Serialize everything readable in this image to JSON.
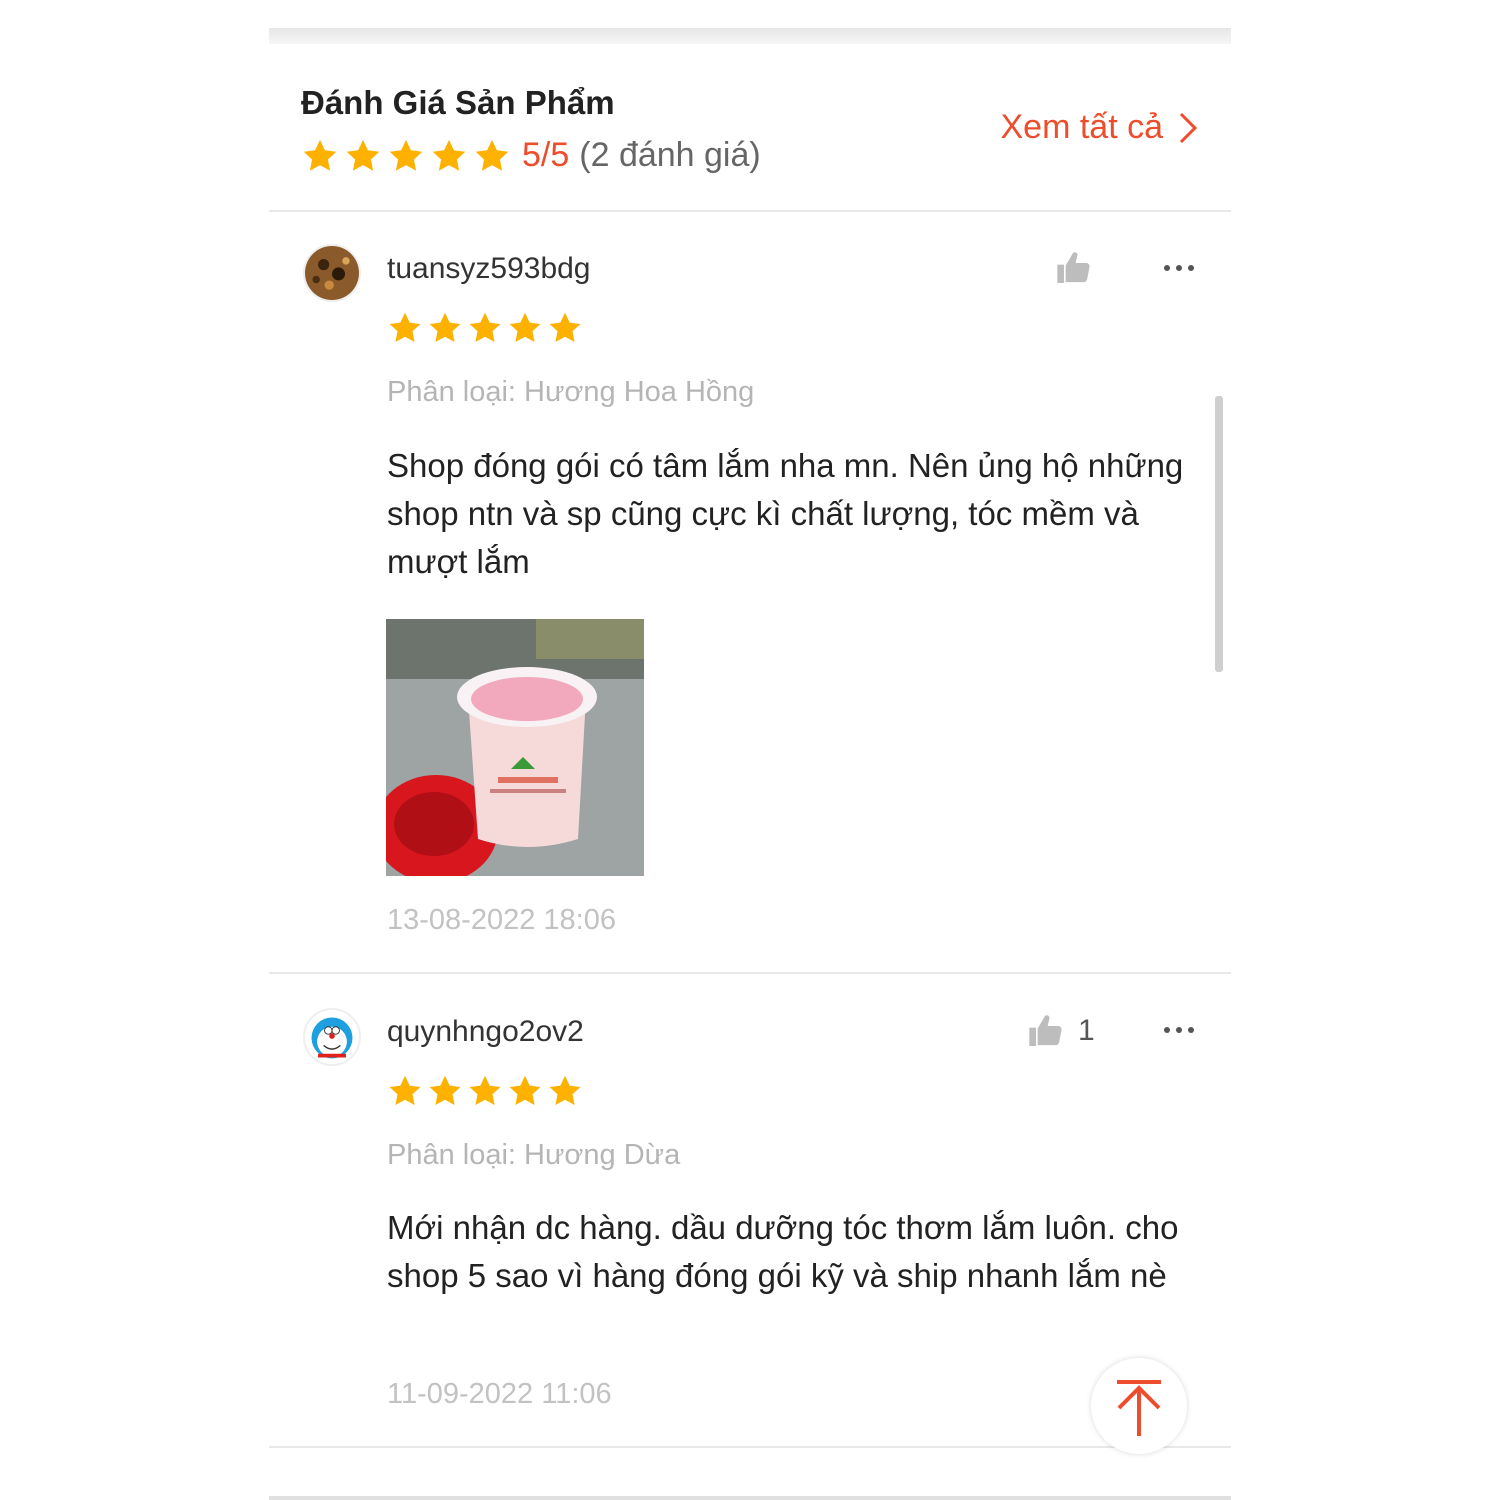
{
  "ratings": {
    "title": "Đánh Giá Sản Phẩm",
    "score": "5/5",
    "count": "(2 đánh giá)",
    "star_count": 5,
    "see_all": "Xem tất cả",
    "accent_color": "#ee4d2d",
    "star_color": "#ffb100"
  },
  "reviews": [
    {
      "username": "tuansyz593bdg",
      "stars": 5,
      "variant": "Phân loại: Hương Hoa Hồng",
      "comment": "Shop đóng gói có tâm lắm nha mn. Nên ủng hộ những shop ntn và sp cũng cực kì chất lượng, tóc mềm và mượt lắm",
      "date": "13-08-2022 18:06",
      "likes": "",
      "has_photo": true,
      "avatar_icon": "leopard-avatar"
    },
    {
      "username": "quynhngo2ov2",
      "stars": 5,
      "variant": "Phân loại: Hương Dừa",
      "comment": "Mới nhận dc hàng. dầu dưỡng tóc thơm lắm luôn.  cho shop 5 sao vì hàng đóng gói kỹ và ship nhanh lắm nè",
      "date": "11-09-2022 11:06",
      "likes": "1",
      "has_photo": false,
      "avatar_icon": "doraemon-avatar"
    }
  ],
  "icons": {
    "like": "thumbs-up-icon",
    "more": "more-options-icon",
    "back_to_top": "arrow-up-icon"
  }
}
